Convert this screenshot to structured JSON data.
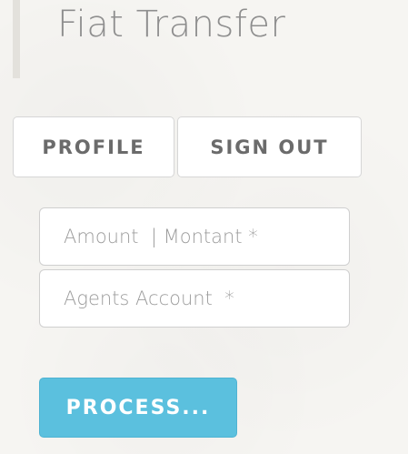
{
  "header": {
    "title": "Fiat Transfer"
  },
  "nav": {
    "profile_label": "PROFILE",
    "signout_label": "SIGN OUT"
  },
  "form": {
    "amount": {
      "value": "",
      "placeholder": "Amount  | Montant *"
    },
    "agents_account": {
      "value": "",
      "placeholder": "Agents Account  *"
    },
    "submit_label": "PROCESS..."
  },
  "colors": {
    "background": "#f6f5f2",
    "title_text": "#8e8e8e",
    "nav_button_text": "#6b6b6b",
    "process_button_bg": "#5bc0de",
    "process_button_text": "#ffffff"
  }
}
